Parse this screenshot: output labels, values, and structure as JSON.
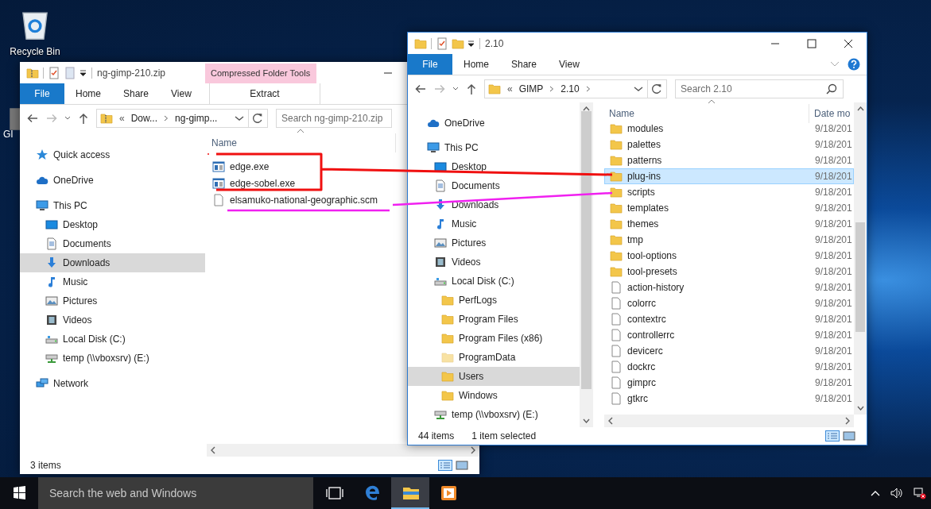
{
  "desktop": {
    "icons": [
      {
        "label": "Recycle Bin",
        "kind": "recycle"
      },
      {
        "label": "GI",
        "kind": "app"
      }
    ]
  },
  "windows": [
    {
      "title": "ng-gimp-210.zip",
      "context_group": "Compressed Folder Tools",
      "tabs": [
        {
          "label": "File",
          "kind": "file"
        },
        {
          "label": "Home",
          "kind": "tab"
        },
        {
          "label": "Share",
          "kind": "tab"
        },
        {
          "label": "View",
          "kind": "tab"
        },
        {
          "label": "Extract",
          "kind": "context"
        }
      ],
      "address": {
        "kind": "zip",
        "prefix": "«",
        "crumbs": [
          "Dow...",
          "ng-gimp..."
        ],
        "trailing_chevron": false
      },
      "search": {
        "placeholder": "Search ng-gimp-210.zip"
      },
      "nav": [
        {
          "label": "Quick access",
          "kind": "star",
          "selected": false
        },
        {
          "label": "OneDrive",
          "kind": "cloud",
          "selected": false
        },
        {
          "label": "This PC",
          "kind": "pc",
          "selected": false,
          "children": [
            {
              "label": "Desktop",
              "kind": "desktop",
              "selected": false
            },
            {
              "label": "Documents",
              "kind": "documents",
              "selected": false
            },
            {
              "label": "Downloads",
              "kind": "downloads",
              "selected": true
            },
            {
              "label": "Music",
              "kind": "music",
              "selected": false
            },
            {
              "label": "Pictures",
              "kind": "pictures",
              "selected": false
            },
            {
              "label": "Videos",
              "kind": "videos",
              "selected": false
            },
            {
              "label": "Local Disk (C:)",
              "kind": "disk",
              "selected": false
            },
            {
              "label": "temp (\\\\vboxsrv) (E:)",
              "kind": "netdrive",
              "selected": false
            }
          ]
        },
        {
          "label": "Network",
          "kind": "network",
          "selected": false
        }
      ],
      "columns": [
        "Name"
      ],
      "files": [
        {
          "name": "edge.exe",
          "kind": "exe",
          "selected": false
        },
        {
          "name": "edge-sobel.exe",
          "kind": "exe",
          "selected": false
        },
        {
          "name": "elsamuko-national-geographic.scm",
          "kind": "file",
          "selected": false
        }
      ],
      "status": {
        "count": "3 items"
      }
    },
    {
      "title": "2.10",
      "tabs": [
        {
          "label": "File",
          "kind": "file"
        },
        {
          "label": "Home",
          "kind": "tab"
        },
        {
          "label": "Share",
          "kind": "tab"
        },
        {
          "label": "View",
          "kind": "tab"
        }
      ],
      "address": {
        "kind": "folder",
        "prefix": "«",
        "crumbs": [
          "GIMP",
          "2.10"
        ],
        "trailing_chevron": true
      },
      "search": {
        "placeholder": "Search 2.10"
      },
      "nav": [
        {
          "label": "OneDrive",
          "kind": "cloud",
          "selected": false
        },
        {
          "label": "This PC",
          "kind": "pc",
          "selected": false,
          "children": [
            {
              "label": "Desktop",
              "kind": "desktop",
              "selected": false
            },
            {
              "label": "Documents",
              "kind": "documents",
              "selected": false
            },
            {
              "label": "Downloads",
              "kind": "downloads",
              "selected": false
            },
            {
              "label": "Music",
              "kind": "music",
              "selected": false
            },
            {
              "label": "Pictures",
              "kind": "pictures",
              "selected": false
            },
            {
              "label": "Videos",
              "kind": "videos",
              "selected": false
            },
            {
              "label": "Local Disk (C:)",
              "kind": "disk",
              "selected": false,
              "children": [
                {
                  "label": "PerfLogs",
                  "kind": "folder",
                  "selected": false
                },
                {
                  "label": "Program Files",
                  "kind": "folder",
                  "selected": false
                },
                {
                  "label": "Program Files (x86)",
                  "kind": "folder",
                  "selected": false
                },
                {
                  "label": "ProgramData",
                  "kind": "hiddenfolder",
                  "selected": false
                },
                {
                  "label": "Users",
                  "kind": "folder",
                  "selected": true
                },
                {
                  "label": "Windows",
                  "kind": "folder",
                  "selected": false
                }
              ]
            },
            {
              "label": "temp (\\\\vboxsrv) (E:)",
              "kind": "netdrive",
              "selected": false
            }
          ]
        }
      ],
      "columns": [
        "Name",
        "Date mo"
      ],
      "files": [
        {
          "name": "modules",
          "date": "9/18/201",
          "kind": "folder",
          "selected": false
        },
        {
          "name": "palettes",
          "date": "9/18/201",
          "kind": "folder",
          "selected": false
        },
        {
          "name": "patterns",
          "date": "9/18/201",
          "kind": "folder",
          "selected": false
        },
        {
          "name": "plug-ins",
          "date": "9/18/201",
          "kind": "folder",
          "selected": true
        },
        {
          "name": "scripts",
          "date": "9/18/201",
          "kind": "folder",
          "selected": false
        },
        {
          "name": "templates",
          "date": "9/18/201",
          "kind": "folder",
          "selected": false
        },
        {
          "name": "themes",
          "date": "9/18/201",
          "kind": "folder",
          "selected": false
        },
        {
          "name": "tmp",
          "date": "9/18/201",
          "kind": "folder",
          "selected": false
        },
        {
          "name": "tool-options",
          "date": "9/18/201",
          "kind": "folder",
          "selected": false
        },
        {
          "name": "tool-presets",
          "date": "9/18/201",
          "kind": "folder",
          "selected": false
        },
        {
          "name": "action-history",
          "date": "9/18/201",
          "kind": "file",
          "selected": false
        },
        {
          "name": "colorrc",
          "date": "9/18/201",
          "kind": "file",
          "selected": false
        },
        {
          "name": "contextrc",
          "date": "9/18/201",
          "kind": "file",
          "selected": false
        },
        {
          "name": "controllerrc",
          "date": "9/18/201",
          "kind": "file",
          "selected": false
        },
        {
          "name": "devicerc",
          "date": "9/18/201",
          "kind": "file",
          "selected": false
        },
        {
          "name": "dockrc",
          "date": "9/18/201",
          "kind": "file",
          "selected": false
        },
        {
          "name": "gimprc",
          "date": "9/18/201",
          "kind": "file",
          "selected": false
        },
        {
          "name": "gtkrc",
          "date": "9/18/201",
          "kind": "file",
          "selected": false
        }
      ],
      "status": {
        "count": "44 items",
        "selection": "1 item selected"
      }
    }
  ],
  "taskbar": {
    "search": {
      "placeholder": "Search the web and Windows"
    },
    "apps": [
      {
        "kind": "taskview",
        "active": false
      },
      {
        "kind": "edge",
        "active": false
      },
      {
        "kind": "explorer",
        "active": true
      },
      {
        "kind": "media",
        "active": false
      }
    ]
  }
}
